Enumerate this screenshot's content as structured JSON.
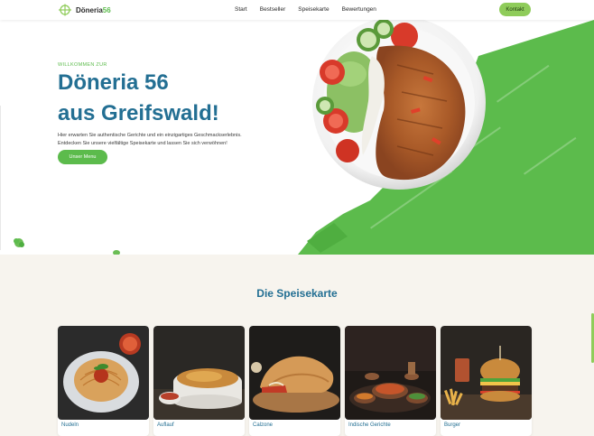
{
  "nav": {
    "logo_prefix": "Döneria",
    "logo_number": "56",
    "links": [
      "Start",
      "Bestseller",
      "Speisekarte",
      "Bewertungen"
    ],
    "cta": "Kontakt"
  },
  "hero": {
    "eyebrow": "WILLKOMMEN ZUR",
    "title_line1": "Döneria 56",
    "title_line2": "aus Greifswald!",
    "lead_line1": "Hier erwarten Sie authentische Gerichte und ein einzigartiges Geschmackserlebnis.",
    "lead_line2": "Entdecken Sie unsere vielfältige Speisekarte und lassen Sie sich verwöhnen!",
    "button": "Unser Menu"
  },
  "menu_section": {
    "title": "Die Speisekarte",
    "cards": [
      {
        "label": "Nudeln"
      },
      {
        "label": "Auflauf"
      },
      {
        "label": "Calzone"
      },
      {
        "label": "Indische Gerichte"
      },
      {
        "label": "Burger"
      }
    ]
  },
  "colors": {
    "brand_blue": "#236f93",
    "brand_green": "#5cbb4c",
    "button_light_green": "#8fcc5a",
    "section_bg": "#f7f4ee"
  }
}
